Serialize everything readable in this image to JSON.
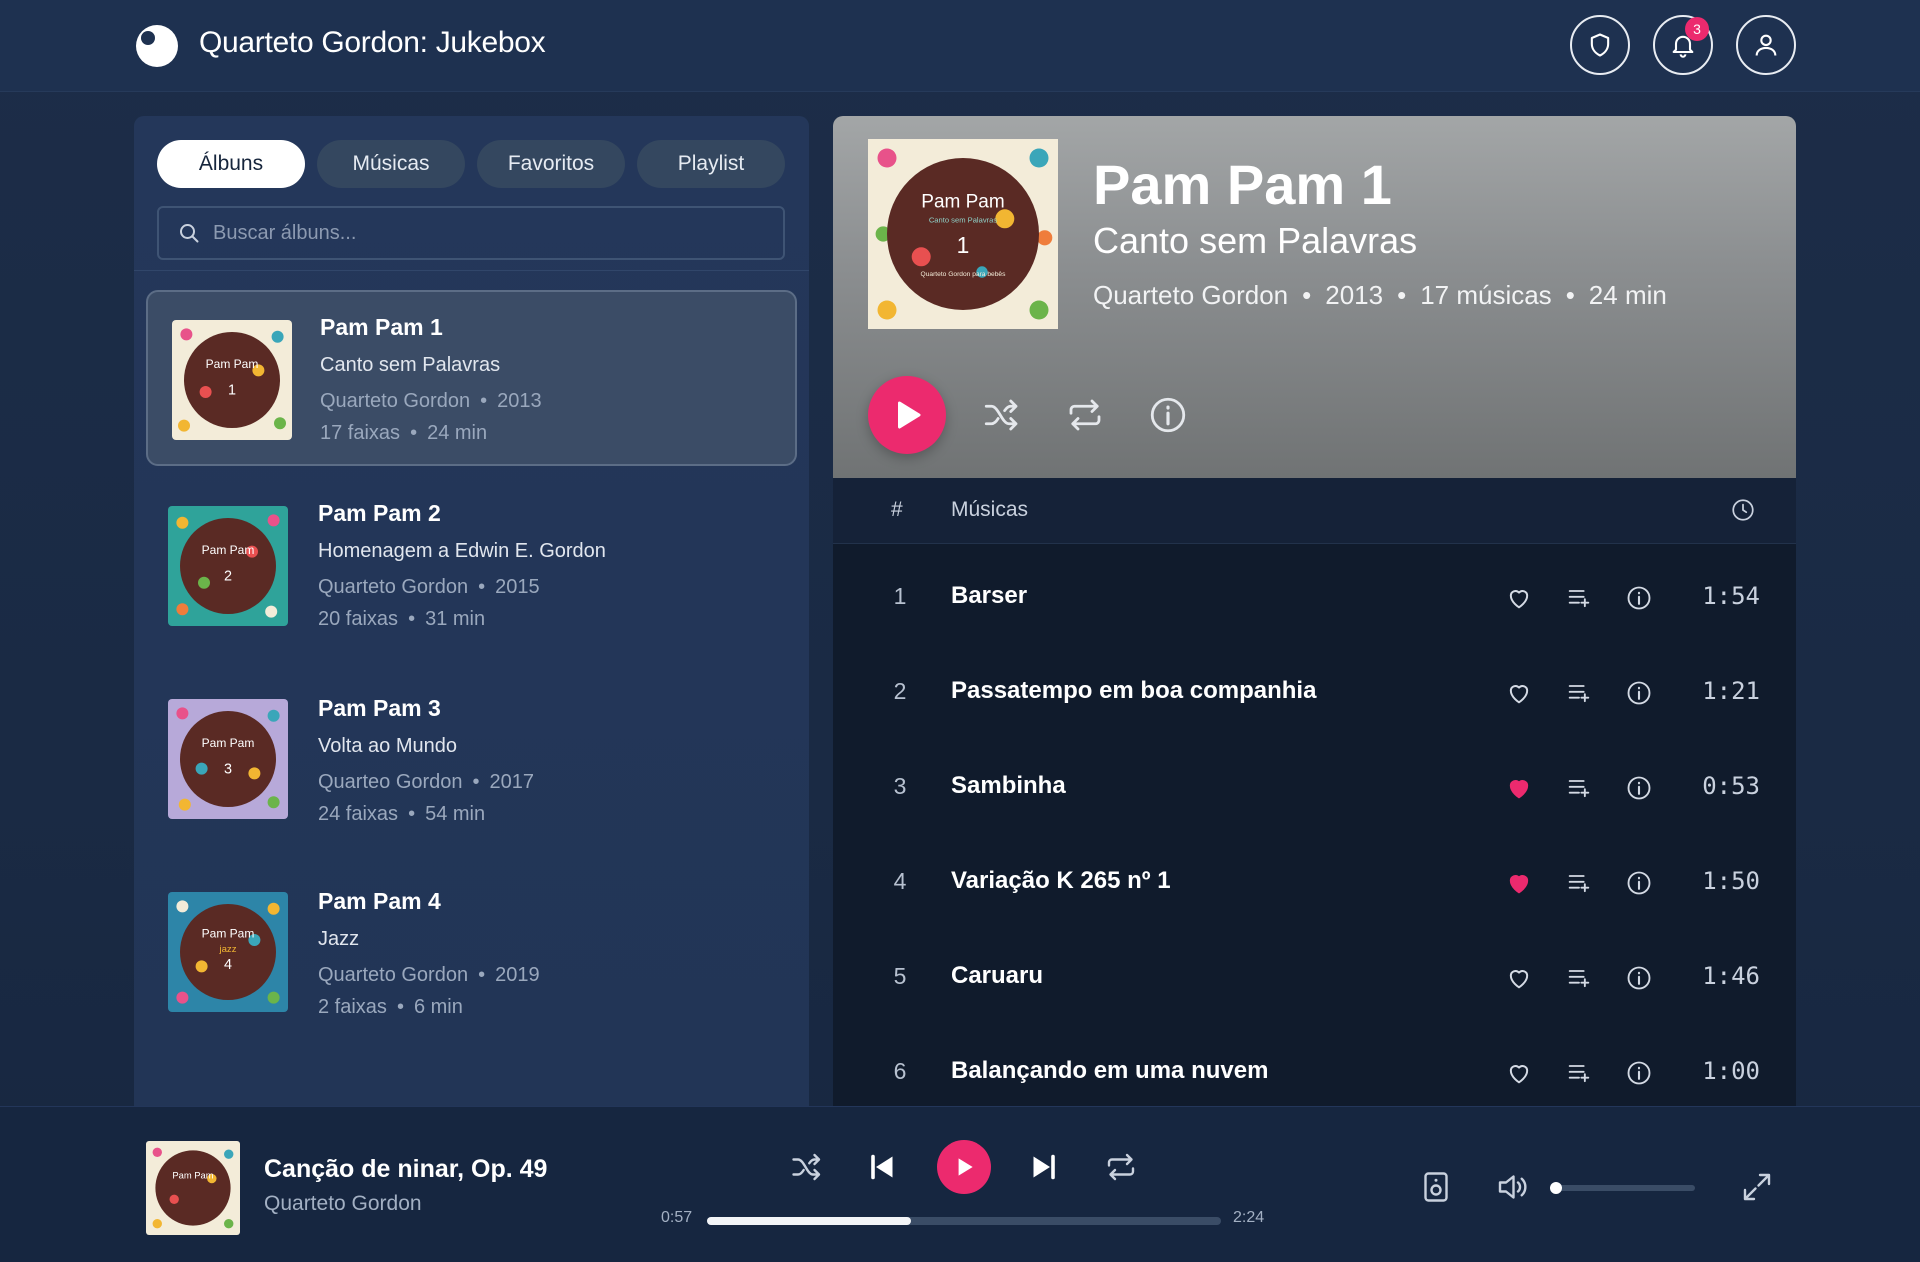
{
  "app": {
    "title": "Quarteto Gordon: Jukebox",
    "notification_count": "3"
  },
  "colors": {
    "accent": "#ec2a6e",
    "background": "#1c2d48"
  },
  "tabs": [
    {
      "label": "Álbuns",
      "active": true
    },
    {
      "label": "Músicas",
      "active": false
    },
    {
      "label": "Favoritos",
      "active": false
    },
    {
      "label": "Playlist",
      "active": false
    }
  ],
  "search": {
    "placeholder": "Buscar álbuns...",
    "value": ""
  },
  "albums": [
    {
      "title": "Pam Pam 1",
      "subtitle": "Canto sem Palavras",
      "artist": "Quarteto Gordon",
      "year": "2013",
      "tracks": "17 faixas",
      "duration": "24 min",
      "cover_number": "1",
      "selected": true
    },
    {
      "title": "Pam Pam 2",
      "subtitle": "Homenagem a Edwin E. Gordon",
      "artist": "Quarteto Gordon",
      "year": "2015",
      "tracks": "20 faixas",
      "duration": "31 min",
      "cover_number": "2",
      "selected": false
    },
    {
      "title": "Pam Pam 3",
      "subtitle": "Volta ao Mundo",
      "artist": "Quarteo Gordon",
      "year": "2017",
      "tracks": "24 faixas",
      "duration": "54 min",
      "cover_number": "3",
      "selected": false
    },
    {
      "title": "Pam Pam 4",
      "subtitle": "Jazz",
      "artist": "Quarteto Gordon",
      "year": "2019",
      "tracks": "2 faixas",
      "duration": "6 min",
      "cover_number": "4",
      "selected": false
    }
  ],
  "detail": {
    "title": "Pam Pam 1",
    "subtitle": "Canto sem Palavras",
    "artist": "Quarteto Gordon",
    "year": "2013",
    "tracks": "17 músicas",
    "duration": "24 min",
    "cover_label": "Pam Pam",
    "cover_sublabel": "Canto sem Palavras",
    "cover_credit": "Quarteto Gordon para bebês"
  },
  "tracklist": {
    "col_num": "#",
    "col_title": "Músicas",
    "tracks": [
      {
        "num": "1",
        "title": "Barser",
        "duration": "1:54",
        "favorite": false
      },
      {
        "num": "2",
        "title": "Passatempo em boa companhia",
        "duration": "1:21",
        "favorite": false
      },
      {
        "num": "3",
        "title": "Sambinha",
        "duration": "0:53",
        "favorite": true
      },
      {
        "num": "4",
        "title": "Variação K 265 nº 1",
        "duration": "1:50",
        "favorite": true
      },
      {
        "num": "5",
        "title": "Caruaru",
        "duration": "1:46",
        "favorite": false
      },
      {
        "num": "6",
        "title": "Balançando em uma nuvem",
        "duration": "1:00",
        "favorite": false
      }
    ]
  },
  "player": {
    "title": "Canção de ninar, Op. 49",
    "artist": "Quarteto Gordon",
    "elapsed": "0:57",
    "total": "2:24",
    "progress_fraction": 0.396,
    "volume_fraction": 0.02
  },
  "icons": {
    "header": [
      "shield-icon",
      "bell-icon",
      "user-icon"
    ],
    "hero": [
      "play-icon",
      "shuffle-icon",
      "repeat-icon",
      "info-icon"
    ],
    "row": [
      "heart-icon",
      "add-to-queue-icon",
      "info-icon"
    ],
    "player": [
      "shuffle-icon",
      "previous-icon",
      "play-icon",
      "next-icon",
      "repeat-icon",
      "speaker-icon",
      "volume-icon",
      "expand-icon"
    ]
  }
}
